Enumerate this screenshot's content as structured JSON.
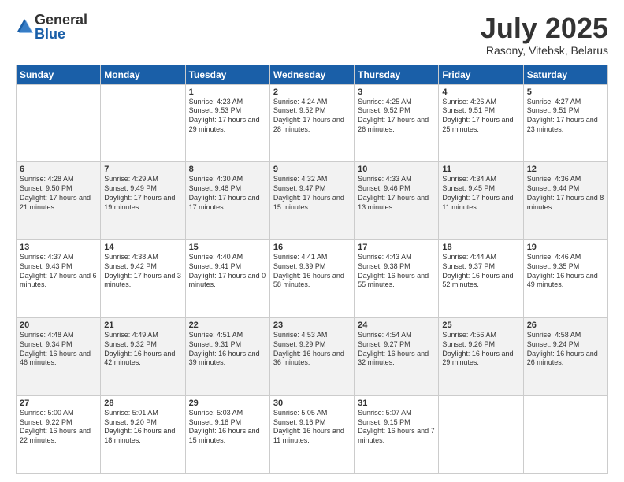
{
  "logo": {
    "general": "General",
    "blue": "Blue"
  },
  "title": {
    "month_year": "July 2025",
    "location": "Rasony, Vitebsk, Belarus"
  },
  "days_of_week": [
    "Sunday",
    "Monday",
    "Tuesday",
    "Wednesday",
    "Thursday",
    "Friday",
    "Saturday"
  ],
  "weeks": [
    [
      {
        "day": "",
        "info": ""
      },
      {
        "day": "",
        "info": ""
      },
      {
        "day": "1",
        "info": "Sunrise: 4:23 AM\nSunset: 9:53 PM\nDaylight: 17 hours and 29 minutes."
      },
      {
        "day": "2",
        "info": "Sunrise: 4:24 AM\nSunset: 9:52 PM\nDaylight: 17 hours and 28 minutes."
      },
      {
        "day": "3",
        "info": "Sunrise: 4:25 AM\nSunset: 9:52 PM\nDaylight: 17 hours and 26 minutes."
      },
      {
        "day": "4",
        "info": "Sunrise: 4:26 AM\nSunset: 9:51 PM\nDaylight: 17 hours and 25 minutes."
      },
      {
        "day": "5",
        "info": "Sunrise: 4:27 AM\nSunset: 9:51 PM\nDaylight: 17 hours and 23 minutes."
      }
    ],
    [
      {
        "day": "6",
        "info": "Sunrise: 4:28 AM\nSunset: 9:50 PM\nDaylight: 17 hours and 21 minutes."
      },
      {
        "day": "7",
        "info": "Sunrise: 4:29 AM\nSunset: 9:49 PM\nDaylight: 17 hours and 19 minutes."
      },
      {
        "day": "8",
        "info": "Sunrise: 4:30 AM\nSunset: 9:48 PM\nDaylight: 17 hours and 17 minutes."
      },
      {
        "day": "9",
        "info": "Sunrise: 4:32 AM\nSunset: 9:47 PM\nDaylight: 17 hours and 15 minutes."
      },
      {
        "day": "10",
        "info": "Sunrise: 4:33 AM\nSunset: 9:46 PM\nDaylight: 17 hours and 13 minutes."
      },
      {
        "day": "11",
        "info": "Sunrise: 4:34 AM\nSunset: 9:45 PM\nDaylight: 17 hours and 11 minutes."
      },
      {
        "day": "12",
        "info": "Sunrise: 4:36 AM\nSunset: 9:44 PM\nDaylight: 17 hours and 8 minutes."
      }
    ],
    [
      {
        "day": "13",
        "info": "Sunrise: 4:37 AM\nSunset: 9:43 PM\nDaylight: 17 hours and 6 minutes."
      },
      {
        "day": "14",
        "info": "Sunrise: 4:38 AM\nSunset: 9:42 PM\nDaylight: 17 hours and 3 minutes."
      },
      {
        "day": "15",
        "info": "Sunrise: 4:40 AM\nSunset: 9:41 PM\nDaylight: 17 hours and 0 minutes."
      },
      {
        "day": "16",
        "info": "Sunrise: 4:41 AM\nSunset: 9:39 PM\nDaylight: 16 hours and 58 minutes."
      },
      {
        "day": "17",
        "info": "Sunrise: 4:43 AM\nSunset: 9:38 PM\nDaylight: 16 hours and 55 minutes."
      },
      {
        "day": "18",
        "info": "Sunrise: 4:44 AM\nSunset: 9:37 PM\nDaylight: 16 hours and 52 minutes."
      },
      {
        "day": "19",
        "info": "Sunrise: 4:46 AM\nSunset: 9:35 PM\nDaylight: 16 hours and 49 minutes."
      }
    ],
    [
      {
        "day": "20",
        "info": "Sunrise: 4:48 AM\nSunset: 9:34 PM\nDaylight: 16 hours and 46 minutes."
      },
      {
        "day": "21",
        "info": "Sunrise: 4:49 AM\nSunset: 9:32 PM\nDaylight: 16 hours and 42 minutes."
      },
      {
        "day": "22",
        "info": "Sunrise: 4:51 AM\nSunset: 9:31 PM\nDaylight: 16 hours and 39 minutes."
      },
      {
        "day": "23",
        "info": "Sunrise: 4:53 AM\nSunset: 9:29 PM\nDaylight: 16 hours and 36 minutes."
      },
      {
        "day": "24",
        "info": "Sunrise: 4:54 AM\nSunset: 9:27 PM\nDaylight: 16 hours and 32 minutes."
      },
      {
        "day": "25",
        "info": "Sunrise: 4:56 AM\nSunset: 9:26 PM\nDaylight: 16 hours and 29 minutes."
      },
      {
        "day": "26",
        "info": "Sunrise: 4:58 AM\nSunset: 9:24 PM\nDaylight: 16 hours and 26 minutes."
      }
    ],
    [
      {
        "day": "27",
        "info": "Sunrise: 5:00 AM\nSunset: 9:22 PM\nDaylight: 16 hours and 22 minutes."
      },
      {
        "day": "28",
        "info": "Sunrise: 5:01 AM\nSunset: 9:20 PM\nDaylight: 16 hours and 18 minutes."
      },
      {
        "day": "29",
        "info": "Sunrise: 5:03 AM\nSunset: 9:18 PM\nDaylight: 16 hours and 15 minutes."
      },
      {
        "day": "30",
        "info": "Sunrise: 5:05 AM\nSunset: 9:16 PM\nDaylight: 16 hours and 11 minutes."
      },
      {
        "day": "31",
        "info": "Sunrise: 5:07 AM\nSunset: 9:15 PM\nDaylight: 16 hours and 7 minutes."
      },
      {
        "day": "",
        "info": ""
      },
      {
        "day": "",
        "info": ""
      }
    ]
  ]
}
